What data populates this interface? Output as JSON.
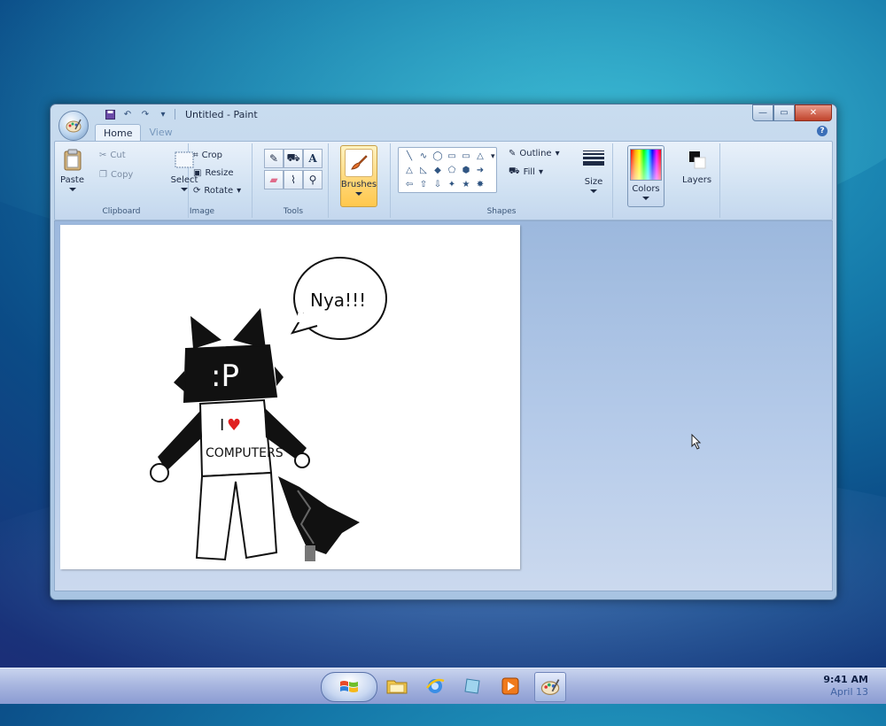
{
  "window": {
    "title": "Untitled - Paint",
    "buttons": {
      "minimize": "—",
      "maximize": "▭",
      "close": "✕"
    }
  },
  "tabs": [
    {
      "label": "Home",
      "active": true
    },
    {
      "label": "View",
      "active": false
    }
  ],
  "ribbon": {
    "clipboard": {
      "label": "Clipboard",
      "paste": "Paste",
      "cut": "Cut",
      "copy": "Copy"
    },
    "image": {
      "label": "Image",
      "select": "Select",
      "crop": "Crop",
      "resize": "Resize",
      "rotate": "Rotate"
    },
    "tools": {
      "label": "Tools",
      "text_tool": "A"
    },
    "brushes": {
      "label": "Brushes"
    },
    "shapes": {
      "label": "Shapes",
      "outline": "Outline",
      "fill": "Fill",
      "glyphs": [
        "╲",
        "∿",
        "◯",
        "▭",
        "▭",
        "△",
        "△",
        "◺",
        "◆",
        "⬠",
        "⬢",
        "➜",
        "⇦",
        "⇧",
        "⇩",
        "✦",
        "★",
        "✸"
      ]
    },
    "size": {
      "label": "Size"
    },
    "colors": {
      "label": "Colors"
    },
    "layers": {
      "label": "Layers"
    }
  },
  "drawing": {
    "speech": "Nya!!!",
    "face": ":P",
    "shirt_line1": "I",
    "heart": "♥",
    "shirt_line2": "COMPUTERS"
  },
  "taskbar": {
    "time": "9:41 AM",
    "date": "April 13"
  },
  "colors": {
    "accent": "#3b6fb8",
    "brushes_highlight": "#ffd87a",
    "heart": "#e02020"
  }
}
